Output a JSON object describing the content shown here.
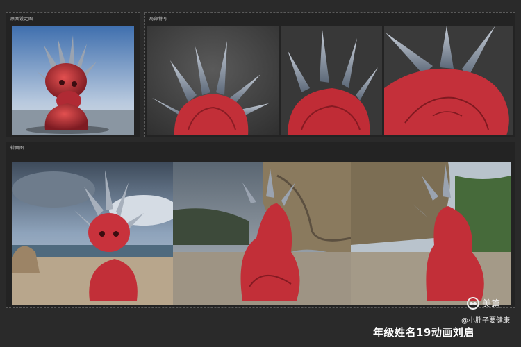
{
  "panels": {
    "concept": {
      "title": "原案设定图"
    },
    "detail": {
      "title": "局部特写"
    },
    "turnaround": {
      "title": "转面图"
    }
  },
  "footer": {
    "title": "年级姓名19动画刘启",
    "credit": "@小胖子要健康",
    "brand_name": "美篇"
  },
  "icons": {
    "brand": "meipian-logo-icon"
  },
  "colors": {
    "background": "#2a2a2a",
    "panel": "#232323",
    "creature_red": "#c9303a",
    "horn_grey": "#8a96a6",
    "sky_blue": "#4f7ab0"
  }
}
